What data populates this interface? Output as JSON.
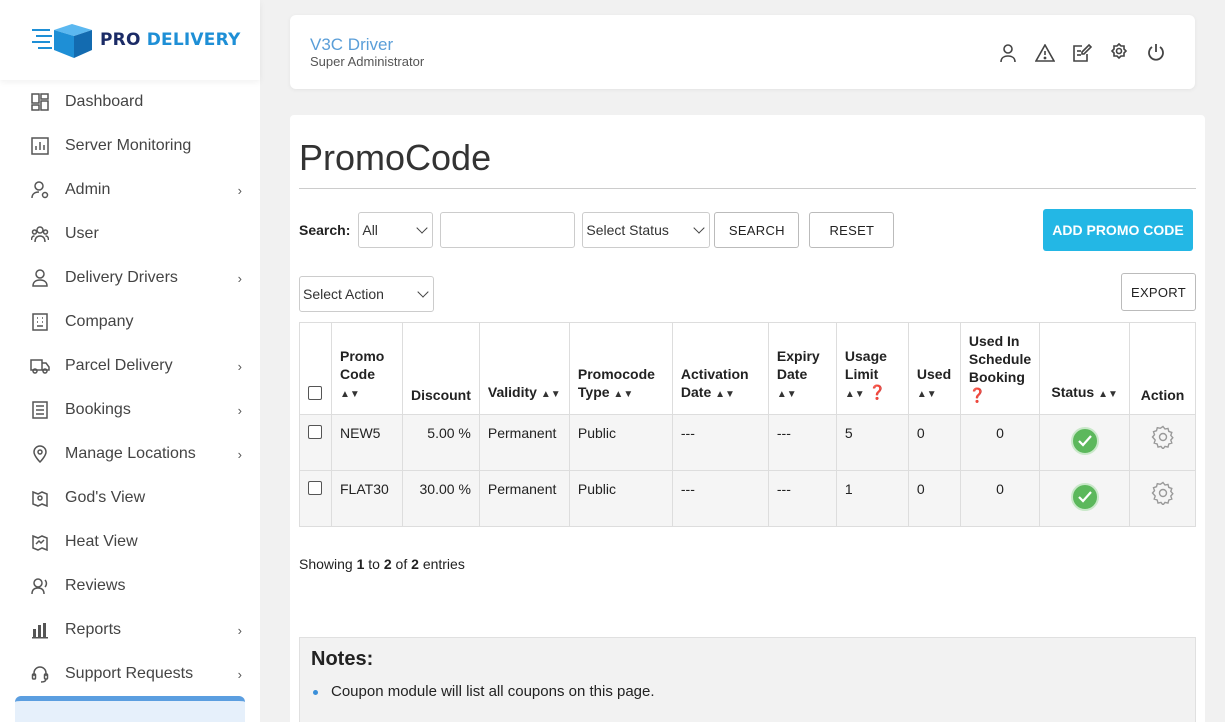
{
  "brand": {
    "logo_part1": "PRO",
    "logo_part2": "DELIVERY"
  },
  "sidebar": {
    "items": [
      {
        "label": "Dashboard",
        "icon": "dashboard-icon",
        "submenu": false
      },
      {
        "label": "Server Monitoring",
        "icon": "monitor-icon",
        "submenu": false
      },
      {
        "label": "Admin",
        "icon": "admin-icon",
        "submenu": true
      },
      {
        "label": "User",
        "icon": "users-icon",
        "submenu": false
      },
      {
        "label": "Delivery Drivers",
        "icon": "driver-icon",
        "submenu": true
      },
      {
        "label": "Company",
        "icon": "building-icon",
        "submenu": false
      },
      {
        "label": "Parcel Delivery",
        "icon": "truck-icon",
        "submenu": true
      },
      {
        "label": "Bookings",
        "icon": "bookings-icon",
        "submenu": true
      },
      {
        "label": "Manage Locations",
        "icon": "location-pin-icon",
        "submenu": true
      },
      {
        "label": "God's View",
        "icon": "map-view-icon",
        "submenu": false
      },
      {
        "label": "Heat View",
        "icon": "heat-map-icon",
        "submenu": false
      },
      {
        "label": "Reviews",
        "icon": "reviews-icon",
        "submenu": false
      },
      {
        "label": "Reports",
        "icon": "bar-chart-icon",
        "submenu": true
      },
      {
        "label": "Support Requests",
        "icon": "headset-icon",
        "submenu": true
      }
    ]
  },
  "header": {
    "name": "V3C Driver",
    "role": "Super Administrator",
    "icons": [
      "profile-icon",
      "alert-icon",
      "edit-note-icon",
      "settings-icon",
      "power-icon"
    ]
  },
  "page": {
    "title": "PromoCode",
    "search_label": "Search:",
    "search_field_value": "All",
    "search_input_value": "",
    "status_select_value": "Select Status",
    "search_button": "SEARCH",
    "reset_button": "RESET",
    "add_button": "ADD PROMO CODE",
    "action_select_value": "Select Action",
    "export_button": "EXPORT"
  },
  "table": {
    "headers": [
      "Promo Code",
      "Discount",
      "Validity",
      "Promocode Type",
      "Activation Date",
      "Expiry Date",
      "Usage Limit",
      "Used",
      "Used In Schedule Booking",
      "Status",
      "Action"
    ],
    "rows": [
      {
        "code": "NEW5",
        "discount": "5.00 %",
        "validity": "Permanent",
        "type": "Public",
        "activation": "---",
        "expiry": "---",
        "limit": "5",
        "used": "0",
        "schedule": "0",
        "status": "active"
      },
      {
        "code": "FLAT30",
        "discount": "30.00 %",
        "validity": "Permanent",
        "type": "Public",
        "activation": "---",
        "expiry": "---",
        "limit": "1",
        "used": "0",
        "schedule": "0",
        "status": "active"
      }
    ]
  },
  "pagination": {
    "prefix": "Showing",
    "from": "1",
    "to_word": "to",
    "to": "2",
    "of_word": "of",
    "total": "2",
    "suffix": "entries"
  },
  "notes": {
    "title": "Notes:",
    "items": [
      "Coupon module will list all coupons on this page."
    ]
  },
  "colors": {
    "accent": "#23b7e5",
    "brand_dark": "#1b2b66",
    "brand_blue": "#1e8fd6",
    "status_green": "#5cb85c"
  }
}
